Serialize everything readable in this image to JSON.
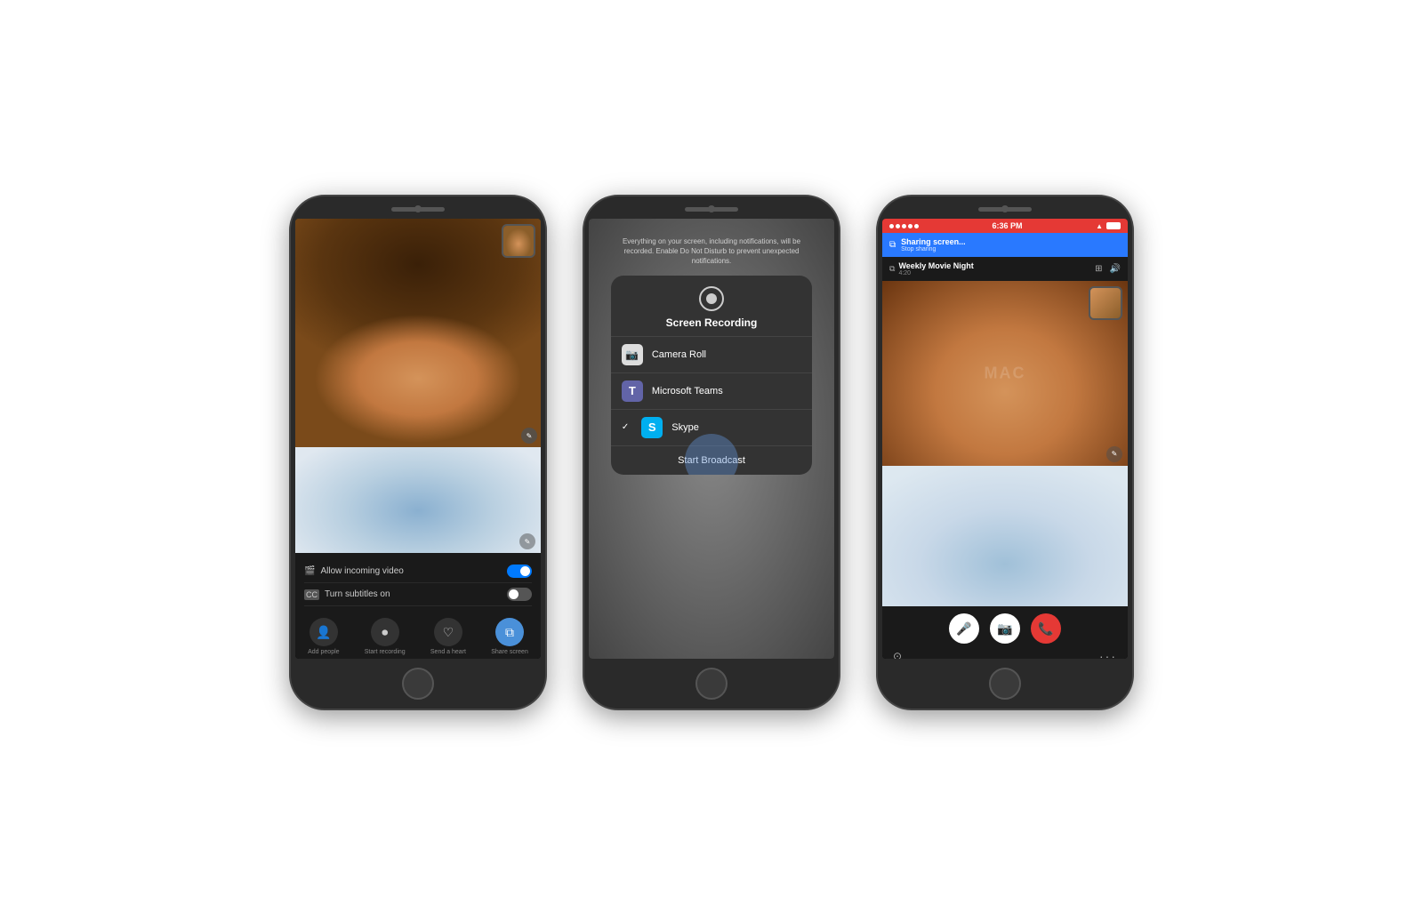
{
  "page": {
    "bg_color": "#ffffff"
  },
  "phone1": {
    "action_buttons": [
      {
        "id": "add-people",
        "label": "Add people",
        "icon": "👤+"
      },
      {
        "id": "start-recording",
        "label": "Start recording",
        "icon": "⏺"
      },
      {
        "id": "send-heart",
        "label": "Send a heart",
        "icon": "♡"
      },
      {
        "id": "share-screen",
        "label": "Share screen",
        "icon": "⧉",
        "active": true
      }
    ],
    "toggles": [
      {
        "label": "Allow incoming video",
        "icon": "🎬",
        "state": "on"
      },
      {
        "label": "Turn subtitles on",
        "icon": "CC",
        "state": "off"
      }
    ]
  },
  "phone2": {
    "hint_text": "Everything on your screen, including notifications, will be recorded. Enable Do Not Disturb to prevent unexpected notifications.",
    "modal_title": "Screen Recording",
    "options": [
      {
        "label": "Camera Roll",
        "icon": "📷",
        "type": "camera-roll"
      },
      {
        "label": "Microsoft Teams",
        "icon": "T",
        "type": "teams"
      },
      {
        "label": "Skype",
        "icon": "S",
        "type": "skype",
        "selected": true
      }
    ],
    "start_button": "Start Broadcast"
  },
  "phone3": {
    "status_bar": {
      "time": "6:36 PM",
      "bg_color": "#E53935"
    },
    "sharing_banner": {
      "title": "Sharing screen...",
      "subtitle": "Stop sharing"
    },
    "call_header": {
      "title": "Weekly Movie Night",
      "subtitle": "4:20"
    },
    "actions": [
      {
        "icon": "🎤",
        "type": "white"
      },
      {
        "icon": "📷",
        "type": "white"
      },
      {
        "icon": "📞",
        "type": "red"
      }
    ]
  }
}
